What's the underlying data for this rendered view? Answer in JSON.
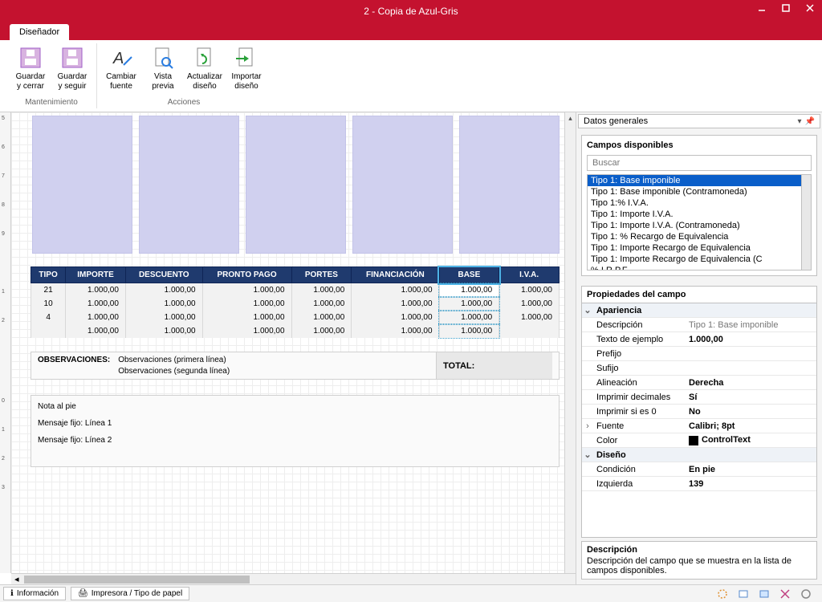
{
  "window": {
    "title": "2 - Copia de Azul-Gris"
  },
  "tab": {
    "designer": "Diseñador"
  },
  "ribbon": {
    "save_close": "Guardar y cerrar",
    "save_continue": "Guardar y seguir",
    "change_font": "Cambiar fuente",
    "preview": "Vista previa",
    "refresh_design": "Actualizar diseño",
    "import_design": "Importar diseño",
    "group_maint": "Mantenimiento",
    "group_actions": "Acciones"
  },
  "table": {
    "headers": [
      "TIPO",
      "IMPORTE",
      "DESCUENTO",
      "PRONTO PAGO",
      "PORTES",
      "FINANCIACIÓN",
      "BASE",
      "I.V.A."
    ],
    "rows": [
      {
        "tipo": "21",
        "importe": "1.000,00",
        "descuento": "1.000,00",
        "pronto": "1.000,00",
        "portes": "1.000,00",
        "fin": "1.000,00",
        "base": "1.000,00",
        "iva": "1.000,00"
      },
      {
        "tipo": "10",
        "importe": "1.000,00",
        "descuento": "1.000,00",
        "pronto": "1.000,00",
        "portes": "1.000,00",
        "fin": "1.000,00",
        "base": "1.000,00",
        "iva": "1.000,00"
      },
      {
        "tipo": "4",
        "importe": "1.000,00",
        "descuento": "1.000,00",
        "pronto": "1.000,00",
        "portes": "1.000,00",
        "fin": "1.000,00",
        "base": "1.000,00",
        "iva": "1.000,00"
      },
      {
        "tipo": "",
        "importe": "1.000,00",
        "descuento": "1.000,00",
        "pronto": "1.000,00",
        "portes": "1.000,00",
        "fin": "1.000,00",
        "base": "1.000,00",
        "iva": ""
      }
    ]
  },
  "obs": {
    "label": "OBSERVACIONES:",
    "line1": "Observaciones (primera línea)",
    "line2": "Observaciones (segunda línea)",
    "total": "TOTAL:"
  },
  "footer": {
    "note": "Nota al pie",
    "msg1": "Mensaje fijo: Línea 1",
    "msg2": "Mensaje fijo: Línea 2"
  },
  "panel": {
    "title": "Datos generales",
    "campos_title": "Campos disponibles",
    "search_placeholder": "Buscar",
    "fields": [
      "Tipo 1: Base imponible",
      "Tipo 1: Base imponible (Contramoneda)",
      "Tipo 1:%  I.V.A.",
      "Tipo 1: Importe I.V.A.",
      "Tipo 1: Importe I.V.A. (Contramoneda)",
      "Tipo 1: % Recargo de Equivalencia",
      "Tipo 1: Importe Recargo de Equivalencia",
      "Tipo 1: Importe Recargo de Equivalencia (C",
      "% I.R.P.F."
    ],
    "props_title": "Propiedades del campo",
    "cat_apariencia": "Apariencia",
    "p_descripcion": "Descripción",
    "v_descripcion": "Tipo 1: Base imponible",
    "p_texto": "Texto de ejemplo",
    "v_texto": "1.000,00",
    "p_prefijo": "Prefijo",
    "v_prefijo": "",
    "p_sufijo": "Sufijo",
    "v_sufijo": "",
    "p_alineacion": "Alineación",
    "v_alineacion": "Derecha",
    "p_imprimir_dec": "Imprimir decimales",
    "v_imprimir_dec": "Sí",
    "p_imprimir_0": "Imprimir si es 0",
    "v_imprimir_0": "No",
    "p_fuente": "Fuente",
    "v_fuente": "Calibri; 8pt",
    "p_color": "Color",
    "v_color": "ControlText",
    "cat_diseno": "Diseño",
    "p_condicion": "Condición",
    "v_condicion": "En pie",
    "p_izquierda": "Izquierda",
    "v_izquierda": "139",
    "desc_title": "Descripción",
    "desc_text": "Descripción del campo que se muestra en la lista de campos disponibles."
  },
  "status": {
    "info": "Información",
    "printer": "Impresora / Tipo de papel"
  },
  "rulers": {
    "r5": "5",
    "r6": "6",
    "r7": "7",
    "r8": "8",
    "r9": "9",
    "r1a": "1",
    "r2a": "2",
    "r0b": "0",
    "r1b": "1",
    "r2b": "2",
    "r3b": "3"
  }
}
